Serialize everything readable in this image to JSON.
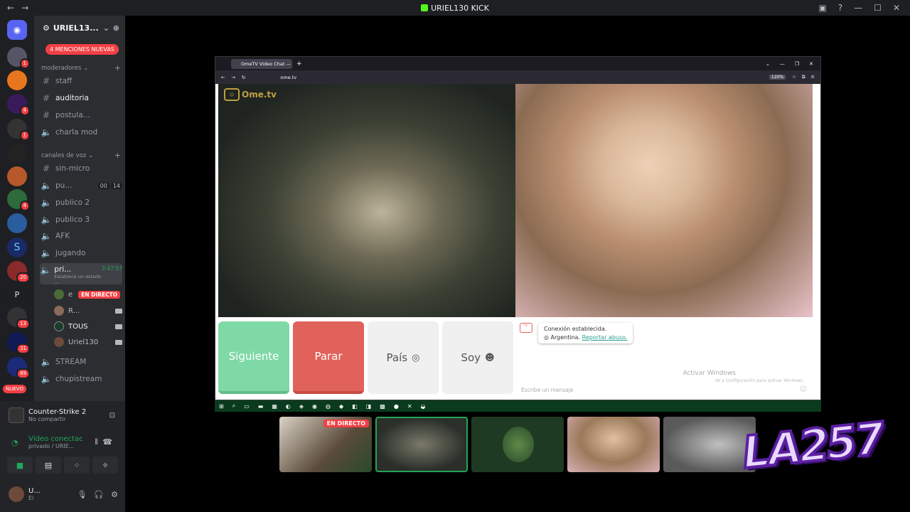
{
  "window": {
    "title": "URIEL130 KICK",
    "controls": [
      "minimize",
      "maximize",
      "close"
    ]
  },
  "rail": {
    "badges": [
      "1",
      "4",
      "1",
      "4",
      "20",
      "13",
      "31",
      "89"
    ],
    "letter": "P",
    "nuevo": "NUEVO"
  },
  "guild": {
    "name": "URIEL13...",
    "mentions": "4 MENCIONES NUEVAS",
    "categories": {
      "moderadores": "moderadores",
      "voz": "canales de voz"
    },
    "channels": {
      "staff": "staff",
      "auditoria": "auditoria",
      "postula": "postula...",
      "charla_mod": "charla mod",
      "sin_micro": "sin-micro",
      "publico1": "pu...",
      "publico1_count_a": "00",
      "publico1_count_b": "14",
      "publico2": "publico 2",
      "publico3": "publico 3",
      "afk": "AFK",
      "jugando": "jugando",
      "privado": "pri...",
      "privado_time": "2:47:57",
      "privado_status": "Establece un estado ...",
      "stream": "STREAM",
      "chupistream": "chupistream"
    },
    "voice_users": [
      {
        "name": "e",
        "live": "EN DIRECTO"
      },
      {
        "name": "R..."
      },
      {
        "name": "TOUS"
      },
      {
        "name": "Uriel130"
      }
    ]
  },
  "activity": {
    "game": "Counter-Strike 2",
    "sub": "No compartir"
  },
  "voice": {
    "status": "Vídeo conectac",
    "channel": "privado / URIE..."
  },
  "user": {
    "name": "U...",
    "status": "Ei"
  },
  "browser": {
    "tab_title": "OmeTV Video Chat — Omeg",
    "url": "ome.tv",
    "zoom": "120%",
    "logo": "Ome.tv",
    "buttons": {
      "next": "Siguiente",
      "stop": "Parar",
      "country": "País",
      "gender": "Soy"
    },
    "chat": {
      "connected": "Conexión establecida.",
      "country": "Argentina.",
      "report": "Reportar abuso.",
      "placeholder": "Escribe un mensaje",
      "watermark1": "Activar Windows",
      "watermark2": "Ve a Configuración para activar Windows."
    }
  },
  "thumbnails": {
    "live": "EN DIRECTO"
  },
  "overlay": {
    "logo_text": "LA257"
  },
  "colors": {
    "discord_bg": "#2b2d31",
    "rail_bg": "#1e1f22",
    "live_red": "#f23f43",
    "next_green": "#7fd9a6",
    "stop_red": "#e1625b",
    "connected_green": "#23a559"
  }
}
